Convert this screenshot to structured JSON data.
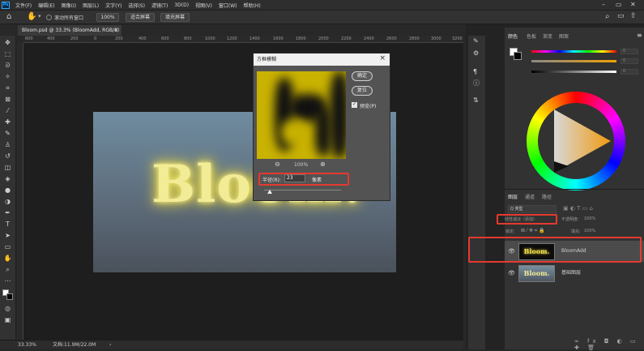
{
  "app": {
    "logo": "Ps"
  },
  "menu": [
    "文件(F)",
    "编辑(E)",
    "图像(I)",
    "图层(L)",
    "文字(Y)",
    "选择(S)",
    "滤镜(T)",
    "3D(D)",
    "视图(V)",
    "窗口(W)",
    "帮助(H)"
  ],
  "options": {
    "scroll_all": "滚动所有窗口",
    "zoom": "100%",
    "fit_screen": "适合屏幕",
    "fill_screen": "填充屏幕"
  },
  "document": {
    "tab": "Bloom.psd @ 33.3% (BloomAdd, RGB/8)",
    "text": "Bloom."
  },
  "ruler_ticks": [
    "600",
    "400",
    "200",
    "0",
    "200",
    "400",
    "600",
    "800",
    "1000",
    "1200",
    "1400",
    "1600",
    "1800",
    "2000",
    "2200",
    "2400",
    "2600",
    "2800",
    "3000",
    "3200"
  ],
  "status": {
    "zoom": "33.33%",
    "doc": "文档:11.9M/22.0M"
  },
  "dialog": {
    "title": "方框模糊",
    "ok": "确定",
    "reset": "复位",
    "preview_label": "预览(P)",
    "preview_checked": true,
    "zoom_value": "100%",
    "radius_label": "半径(R):",
    "radius_value": "23",
    "radius_unit": "像素"
  },
  "panels": {
    "color_tabs": [
      "颜色",
      "色板",
      "渐变",
      "图案"
    ],
    "color_values": [
      "0",
      "0",
      "0"
    ],
    "layer_tabs": [
      "图层",
      "通道",
      "路径"
    ],
    "filter_label": "Q 类型",
    "blend_mode": "线性减淡（添加）",
    "opacity_label": "不透明度:",
    "opacity_value": "100%",
    "lock_label": "锁定:",
    "fill_label": "填充:",
    "fill_value": "100%",
    "layers": [
      {
        "name": "BloomAdd",
        "thumb_text": "Bloom.",
        "visible": true,
        "selected": true
      },
      {
        "name": "基础图层",
        "thumb_text": "Bloom.",
        "visible": true,
        "selected": false
      }
    ]
  },
  "colors": {
    "accent_red": "#e53a2f",
    "glow": "#f0df4a",
    "preview_yellow": "#c9b200"
  }
}
